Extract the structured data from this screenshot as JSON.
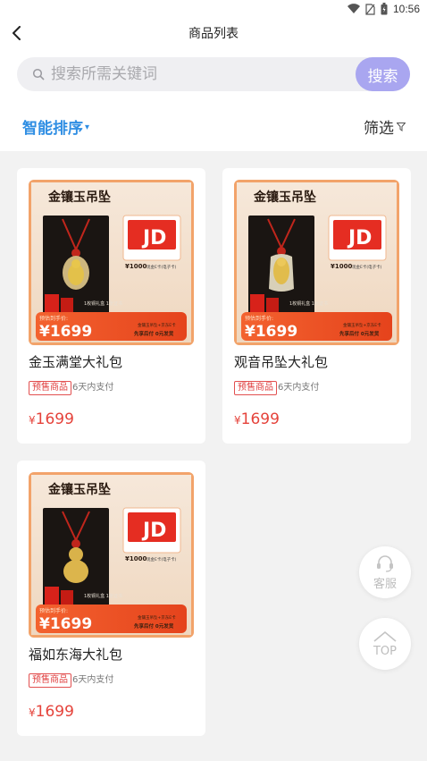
{
  "status_bar": {
    "time": "10:56",
    "icons": [
      "wifi-icon",
      "sim-icon",
      "battery-icon"
    ]
  },
  "nav": {
    "title": "商品列表",
    "back_icon": "back-arrow-icon"
  },
  "search": {
    "placeholder": "搜索所需关键词",
    "button_label": "搜索",
    "icon": "search-icon"
  },
  "sort": {
    "smart_label": "智能排序",
    "filter_label": "筛选",
    "accent": "#2f8ee3"
  },
  "products": [
    {
      "name": "金玉满堂大礼包",
      "tag": "预售商品",
      "pay_note": "6天内支付",
      "price_symbol": "¥",
      "price": "1699",
      "image": {
        "heading": "金镶玉吊坠",
        "card_text": "JD",
        "card_value": "¥1000",
        "card_note": "现金E卡(电子卡)",
        "box_note": "1枚铜礼盒 1张证书",
        "badge_label": "预估到手价:",
        "badge_price": "¥1699",
        "footer_title": "金镶玉吊坠+京东E卡",
        "footer_slogan": "先享后付  0元发货"
      }
    },
    {
      "name": "观音吊坠大礼包",
      "tag": "预售商品",
      "pay_note": "6天内支付",
      "price_symbol": "¥",
      "price": "1699",
      "image": {
        "heading": "金镶玉吊坠",
        "card_text": "JD",
        "card_value": "¥1000",
        "card_note": "现金E卡(电子卡)",
        "box_note": "1枚铜礼盒 1张证书",
        "badge_label": "预估到手价:",
        "badge_price": "¥1699",
        "footer_title": "金镶玉吊坠+京东E卡",
        "footer_slogan": "先享后付  0元发货"
      }
    },
    {
      "name": "福如东海大礼包",
      "tag": "预售商品",
      "pay_note": "6天内支付",
      "price_symbol": "¥",
      "price": "1699",
      "image": {
        "heading": "金镶玉吊坠",
        "card_text": "JD",
        "card_value": "¥1000",
        "card_note": "现金E卡(电子卡)",
        "box_note": "1枚铜礼盒 1张证书",
        "badge_label": "预估到手价:",
        "badge_price": "¥1699",
        "footer_title": "金镶玉吊坠+京东E卡",
        "footer_slogan": "先享后付  0元发货"
      }
    }
  ],
  "floating": {
    "service_label": "客服",
    "top_label": "TOP"
  },
  "colors": {
    "price": "#e5433b",
    "search_button": "#a9a6f0",
    "badge": "#e8562c"
  }
}
